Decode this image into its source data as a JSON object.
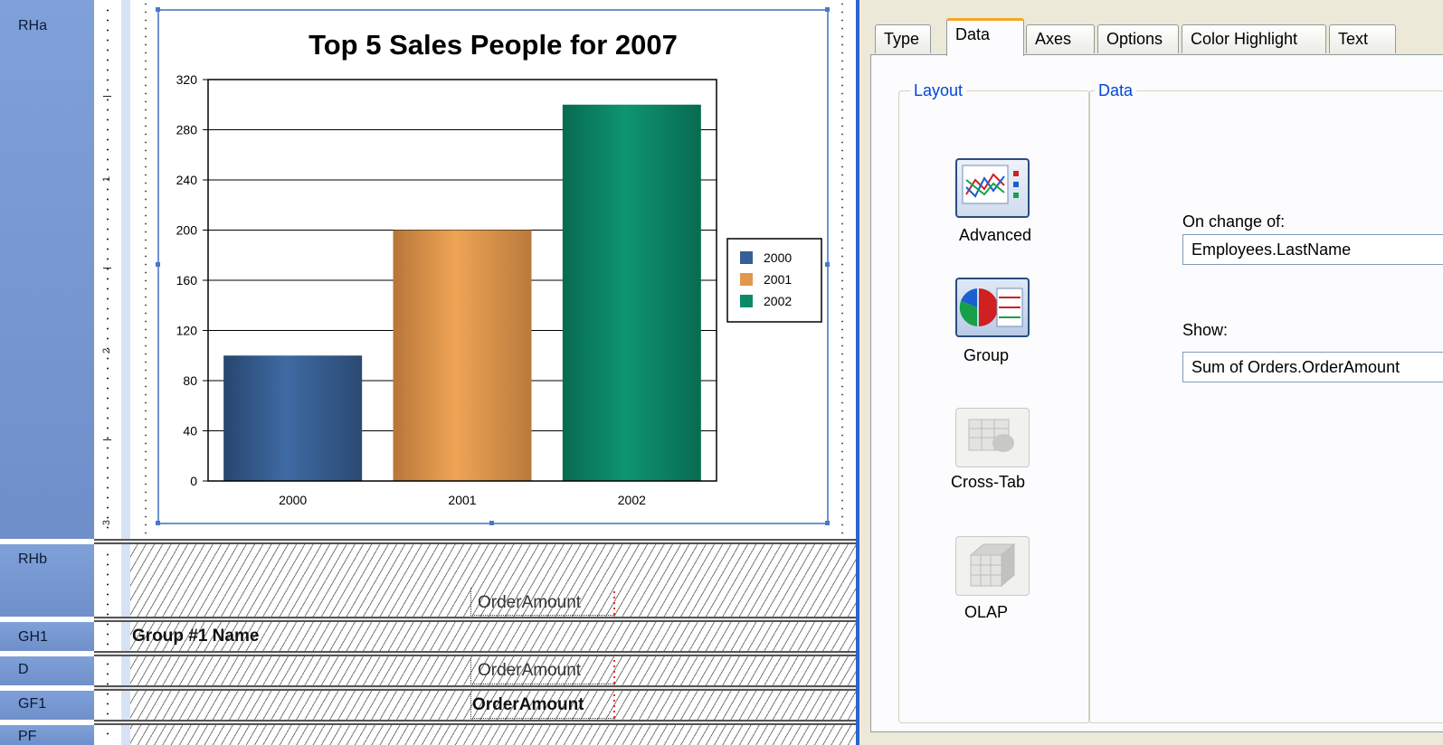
{
  "designer": {
    "sections": [
      {
        "label": "RHa"
      },
      {
        "label": "RHb"
      },
      {
        "label": "GH1"
      },
      {
        "label": "D"
      },
      {
        "label": "GF1"
      },
      {
        "label": "PF"
      }
    ],
    "ruler_numbers": [
      "1",
      "2",
      "3"
    ],
    "fields": {
      "rhb_field": "OrderAmount",
      "gh1_field": "Group #1 Name",
      "d_field": "OrderAmount",
      "gf1_field": "OrderAmount"
    }
  },
  "chart_data": {
    "type": "bar",
    "title": "Top 5 Sales People for 2007",
    "categories": [
      "2000",
      "2001",
      "2002"
    ],
    "values": [
      100,
      200,
      300
    ],
    "ylim": [
      0,
      320
    ],
    "yticks": [
      0,
      40,
      80,
      120,
      160,
      200,
      240,
      280,
      320
    ],
    "grid": true,
    "legend_position": "right",
    "legend": [
      "2000",
      "2001",
      "2002"
    ],
    "colors": [
      "#365f95",
      "#e2974c",
      "#0b8a68"
    ],
    "xlabel": "",
    "ylabel": ""
  },
  "expert": {
    "tabs": [
      "Type",
      "Data",
      "Axes",
      "Options",
      "Color Highlight",
      "Text"
    ],
    "active_tab": "Data",
    "layout_group": {
      "title": "Layout",
      "buttons": [
        {
          "label": "Advanced",
          "icon": "advanced-chart-icon",
          "selected": false
        },
        {
          "label": "Group",
          "icon": "group-chart-icon",
          "selected": true
        },
        {
          "label": "Cross-Tab",
          "icon": "cross-tab-icon",
          "selected": false,
          "enabled": false
        },
        {
          "label": "OLAP",
          "icon": "olap-icon",
          "selected": false,
          "enabled": false
        }
      ]
    },
    "data_group": {
      "title": "Data",
      "on_change_label": "On change of:",
      "on_change_value": "Employees.LastName",
      "show_label": "Show:",
      "show_value": "Sum of Orders.OrderAmount"
    }
  }
}
